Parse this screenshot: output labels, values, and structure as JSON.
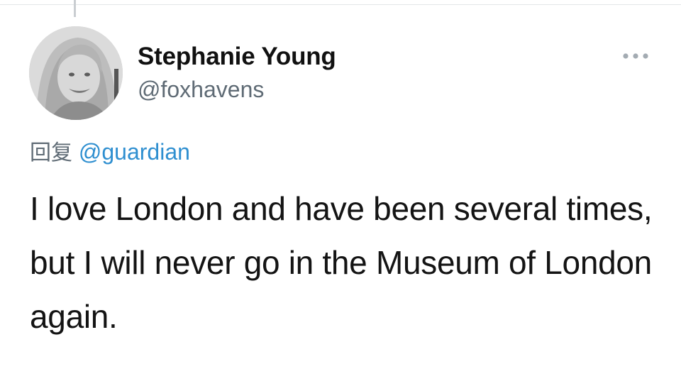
{
  "tweet": {
    "author": {
      "display_name": "Stephanie Young",
      "handle": "@foxhavens"
    },
    "reply": {
      "prefix": "回复",
      "mention": "@guardian"
    },
    "text": "I love London and have been several times, but I will never go in the Museum of London again.",
    "more_icon": "more-horizontal-icon"
  },
  "colors": {
    "mention": "#2f8fd0",
    "handle": "#5f6b75",
    "text": "#141414"
  }
}
